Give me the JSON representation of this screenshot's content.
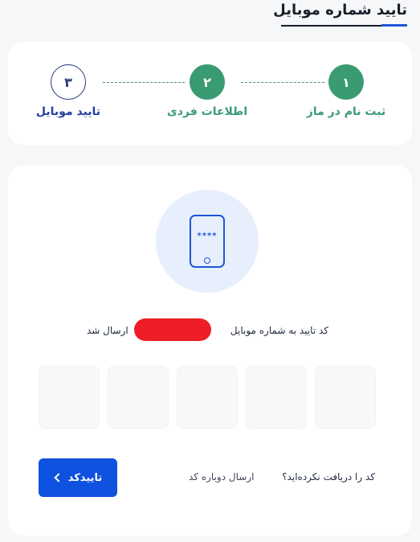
{
  "page": {
    "title": "تایید شماره موبایل"
  },
  "steps": [
    {
      "number": "۱",
      "label": "ثبت نام در ماز",
      "status": "done"
    },
    {
      "number": "۲",
      "label": "اطلاعات فردی",
      "status": "done"
    },
    {
      "number": "۳",
      "label": "تایید موبایل",
      "status": "current"
    }
  ],
  "verification": {
    "phone_icon_text": "****",
    "sent_message_prefix": "کد تایید به شماره موبایل",
    "sent_message_suffix": "ارسال شد",
    "code_boxes": [
      "",
      "",
      "",
      "",
      ""
    ]
  },
  "actions": {
    "confirm_label": "تاییدکد",
    "not_received": "کد را دریافت نکرده‌اید؟",
    "resend_label": "ارسال دوباره کد"
  },
  "colors": {
    "primary": "#0f52e0",
    "step_done": "#3a9b73",
    "step_pending": "#233a7a",
    "redaction": "#ee1d27"
  }
}
